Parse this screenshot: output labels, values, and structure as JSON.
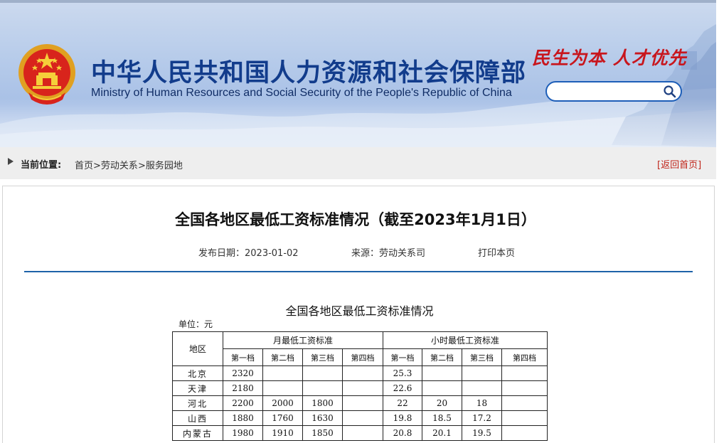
{
  "header": {
    "title_cn": "中华人民共和国人力资源和社会保障部",
    "title_en": "Ministry of Human Resources and Social Security of the People's Republic of China",
    "slogan": "民生为本 人才优先",
    "search_placeholder": ""
  },
  "breadcrumb": {
    "label": "当前位置:",
    "items": [
      "首页",
      "劳动关系",
      "服务园地"
    ],
    "separator": ">",
    "back_home": "[返回首页]"
  },
  "article": {
    "title": "全国各地区最低工资标准情况（截至2023年1月1日）",
    "date": "发布日期：2023-01-02",
    "source": "来源：劳动关系司",
    "print": "打印本页"
  },
  "table": {
    "title": "全国各地区最低工资标准情况",
    "unit": "单位：元",
    "region_header": "地区",
    "monthly_header": "月最低工资标准",
    "hourly_header": "小时最低工资标准",
    "tiers": [
      "第一档",
      "第二档",
      "第三档",
      "第四档"
    ],
    "rows": [
      {
        "region": "北京",
        "monthly": [
          "2320",
          "",
          "",
          ""
        ],
        "hourly": [
          "25.3",
          "",
          "",
          ""
        ]
      },
      {
        "region": "天津",
        "monthly": [
          "2180",
          "",
          "",
          ""
        ],
        "hourly": [
          "22.6",
          "",
          "",
          ""
        ]
      },
      {
        "region": "河北",
        "monthly": [
          "2200",
          "2000",
          "1800",
          ""
        ],
        "hourly": [
          "22",
          "20",
          "18",
          ""
        ]
      },
      {
        "region": "山西",
        "monthly": [
          "1880",
          "1760",
          "1630",
          ""
        ],
        "hourly": [
          "19.8",
          "18.5",
          "17.2",
          ""
        ]
      },
      {
        "region": "内蒙古",
        "monthly": [
          "1980",
          "1910",
          "1850",
          ""
        ],
        "hourly": [
          "20.8",
          "20.1",
          "19.5",
          ""
        ]
      }
    ]
  },
  "colors": {
    "title_blue": "#123c8c",
    "accent_blue": "#1e63a8",
    "slogan_red": "#c8161d",
    "link_red": "#c0261b"
  }
}
